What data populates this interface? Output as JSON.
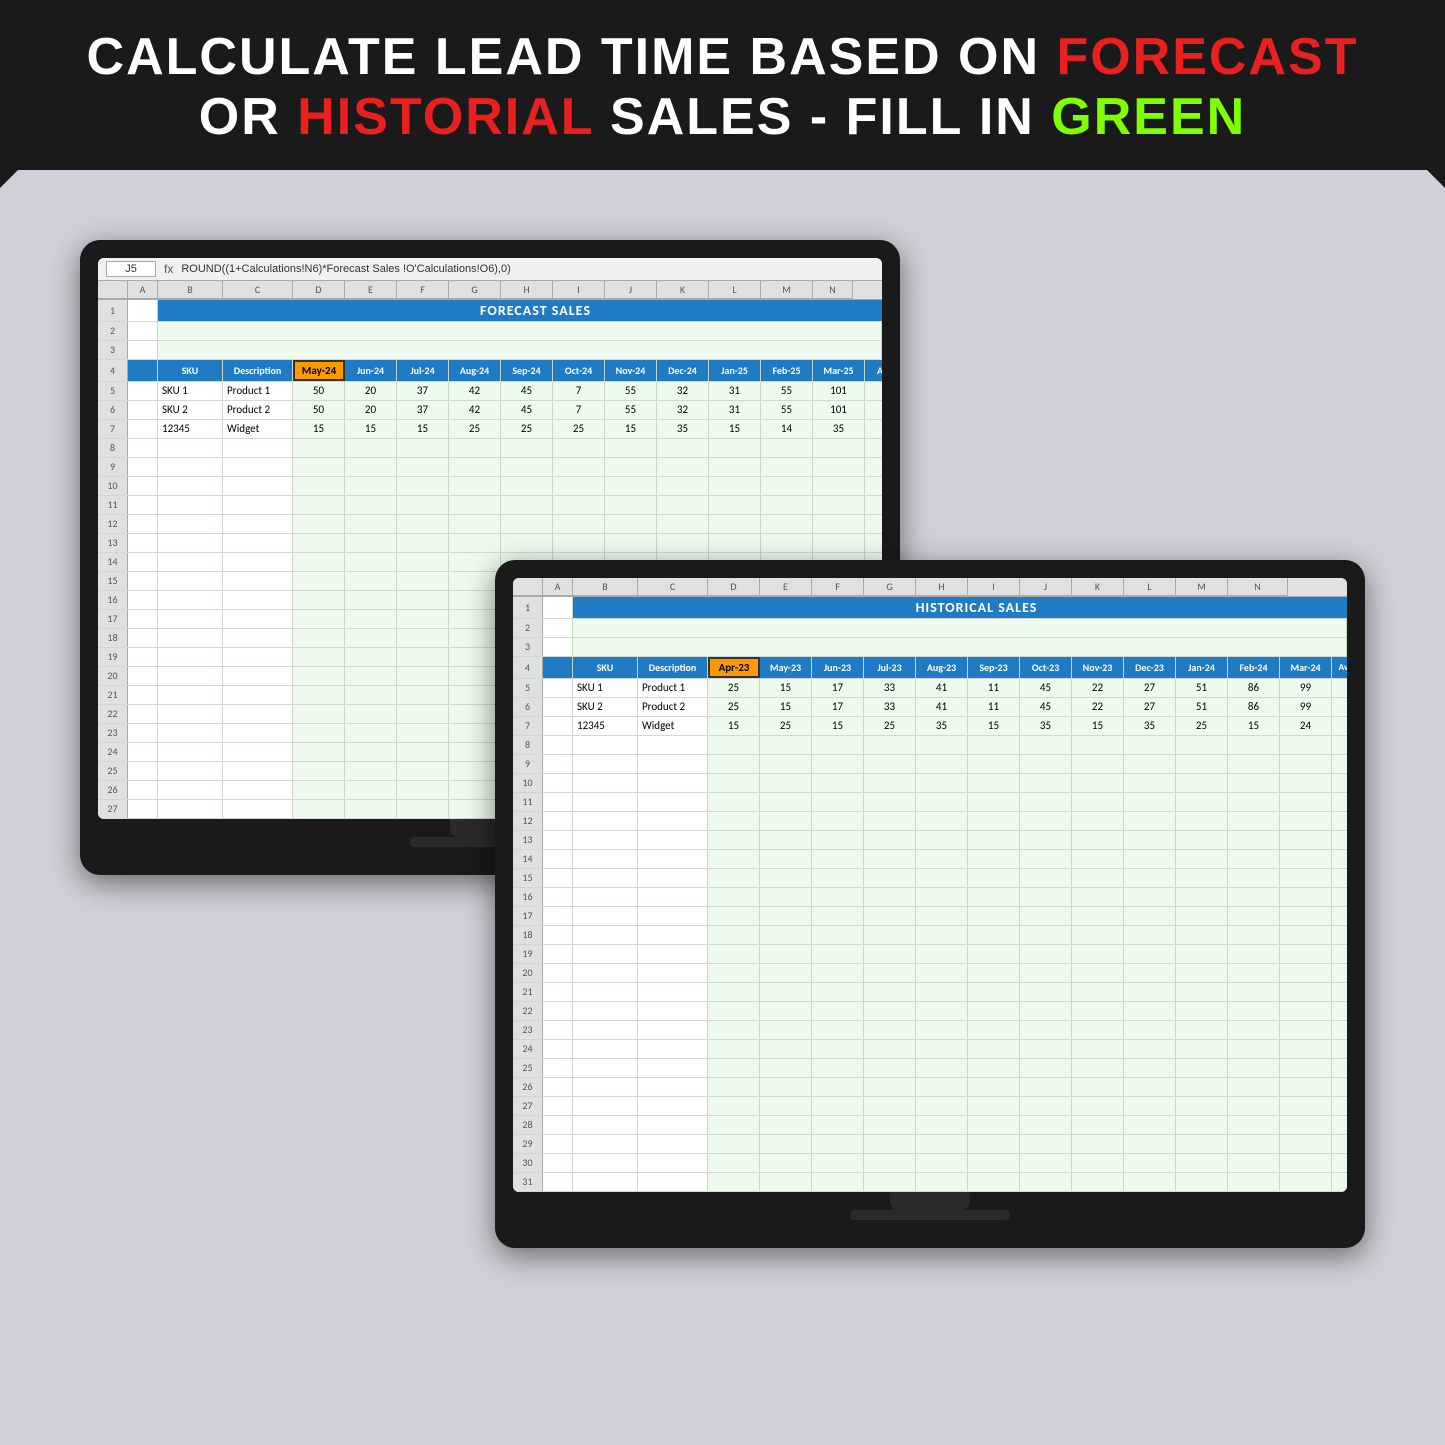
{
  "banner": {
    "line1_part1": "CALCULATE LEAD TIME BASED ON ",
    "line1_red": "FORECAST",
    "line2_part1": "OR ",
    "line2_red": "HISTORIAL",
    "line2_part2": " SALES - FILL IN ",
    "line2_green": "GREEN"
  },
  "formula_bar": {
    "namebox": "J5",
    "formula": "ROUND((1+Calculations!N6)*Forecast Sales !O'Calculations!O6),0)"
  },
  "forecast_sheet": {
    "title": "FORECAST SALES",
    "headers": [
      "SKU",
      "Description",
      "May-24",
      "Jun-24",
      "Jul-24",
      "Aug-24",
      "Sep-24",
      "Oct-24",
      "Nov-24",
      "Dec-24",
      "Jan-25",
      "Feb-25",
      "Mar-25",
      "Apr"
    ],
    "selected_col": "May-24",
    "rows": [
      {
        "row": "5",
        "sku": "SKU 1",
        "desc": "Product 1",
        "vals": [
          "50",
          "20",
          "37",
          "42",
          "45",
          "7",
          "55",
          "32",
          "31",
          "55",
          "101",
          ""
        ]
      },
      {
        "row": "6",
        "sku": "SKU 2",
        "desc": "Product 2",
        "vals": [
          "50",
          "20",
          "37",
          "42",
          "45",
          "7",
          "55",
          "32",
          "31",
          "55",
          "101",
          ""
        ]
      },
      {
        "row": "7",
        "sku": "12345",
        "desc": "Widget",
        "vals": [
          "15",
          "15",
          "15",
          "25",
          "25",
          "25",
          "15",
          "35",
          "15",
          "14",
          "35",
          ""
        ]
      }
    ],
    "empty_rows": [
      "8",
      "9",
      "10",
      "11",
      "12",
      "13",
      "14",
      "15",
      "16",
      "17",
      "18",
      "19",
      "20",
      "21",
      "22",
      "23",
      "24",
      "25",
      "26",
      "27"
    ]
  },
  "historical_sheet": {
    "title": "HISTORICAL SALES",
    "headers": [
      "SKU",
      "Description",
      "Apr-23",
      "May-23",
      "Jun-23",
      "Jul-23",
      "Aug-23",
      "Sep-23",
      "Oct-23",
      "Nov-23",
      "Dec-23",
      "Jan-24",
      "Feb-24",
      "Mar-24",
      "Ave Da Dem"
    ],
    "selected_col": "Apr-23",
    "rows": [
      {
        "row": "5",
        "sku": "SKU 1",
        "desc": "Product 1",
        "vals": [
          "25",
          "15",
          "17",
          "33",
          "41",
          "11",
          "45",
          "22",
          "27",
          "51",
          "86",
          "99",
          ""
        ]
      },
      {
        "row": "6",
        "sku": "SKU 2",
        "desc": "Product 2",
        "vals": [
          "25",
          "15",
          "17",
          "33",
          "41",
          "11",
          "45",
          "22",
          "27",
          "51",
          "86",
          "99",
          ""
        ]
      },
      {
        "row": "7",
        "sku": "12345",
        "desc": "Widget",
        "vals": [
          "15",
          "25",
          "15",
          "25",
          "35",
          "15",
          "35",
          "15",
          "35",
          "25",
          "15",
          "24",
          ""
        ]
      }
    ],
    "empty_rows": [
      "8",
      "9",
      "10",
      "11",
      "12",
      "13",
      "14",
      "15",
      "16",
      "17",
      "18",
      "19",
      "20",
      "21",
      "22",
      "23",
      "24",
      "25",
      "26",
      "27",
      "28",
      "29",
      "30",
      "31"
    ]
  }
}
